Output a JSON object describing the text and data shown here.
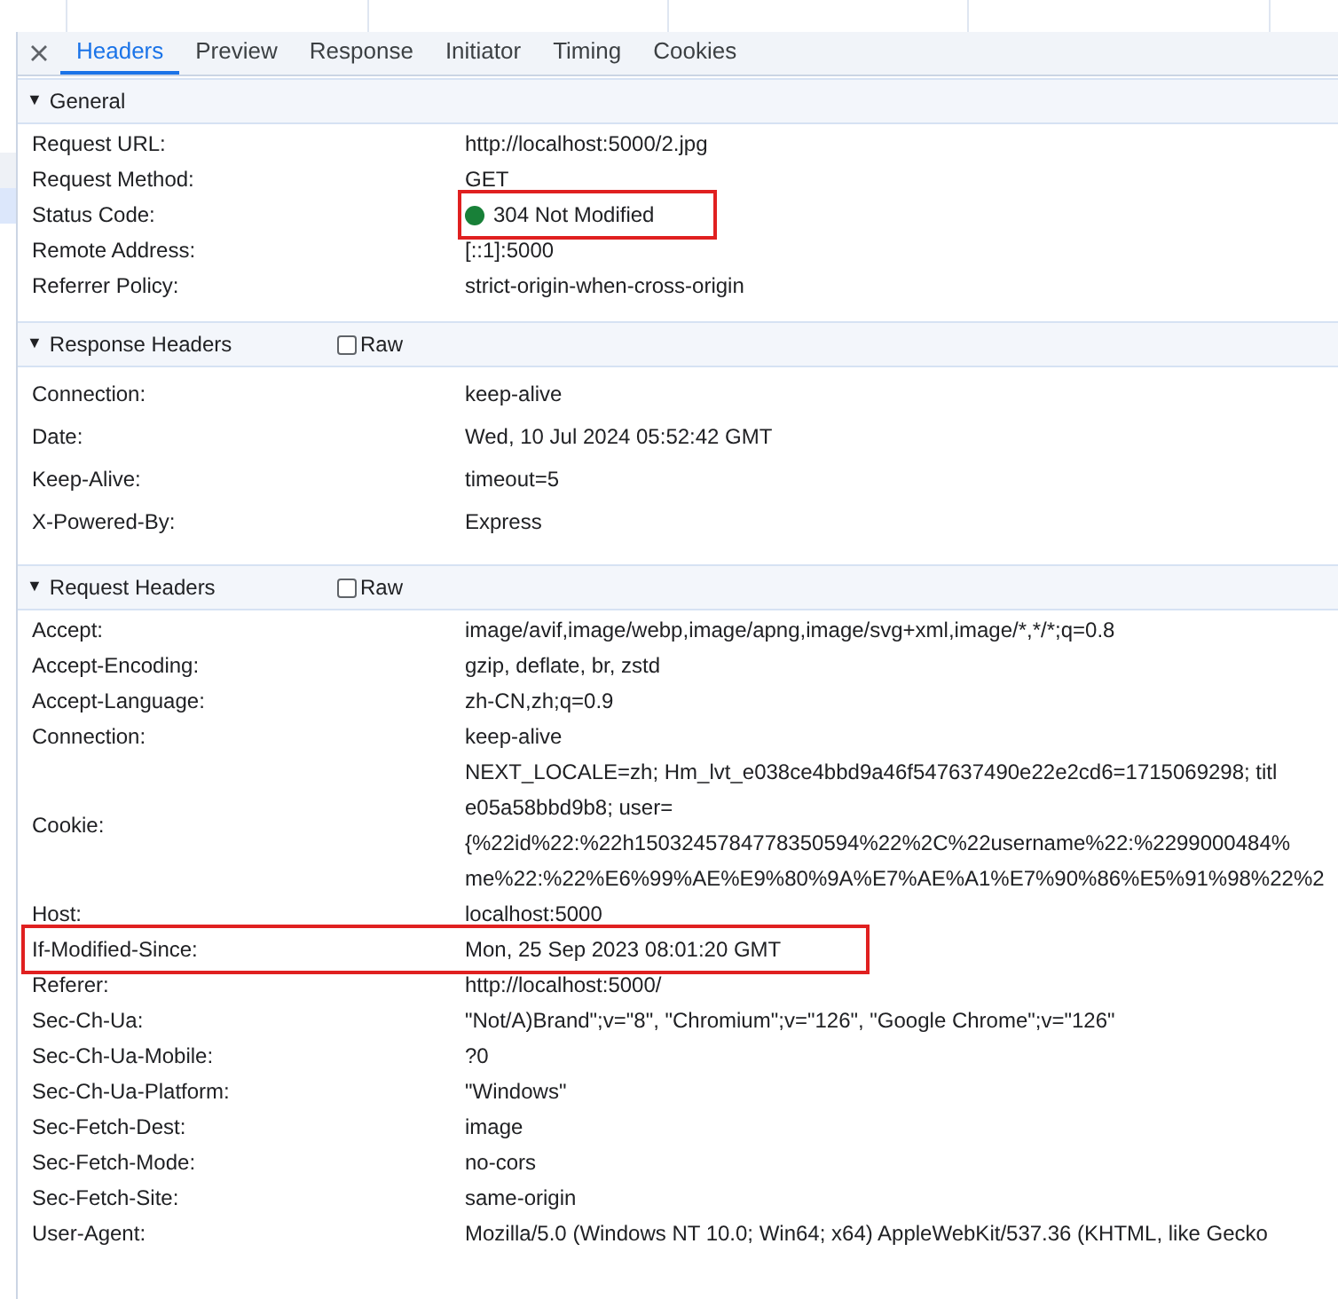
{
  "tabs": [
    {
      "label": "Headers",
      "selected": true
    },
    {
      "label": "Preview",
      "selected": false
    },
    {
      "label": "Response",
      "selected": false
    },
    {
      "label": "Initiator",
      "selected": false
    },
    {
      "label": "Timing",
      "selected": false
    },
    {
      "label": "Cookies",
      "selected": false
    }
  ],
  "sections": [
    {
      "title": "General",
      "marker": "▼",
      "rows": [
        {
          "name": "Request URL:",
          "value": [
            "http://localhost:5000/2.jpg"
          ],
          "kind": "plain",
          "highlighted": false
        },
        {
          "name": "Request Method:",
          "value": [
            "GET"
          ],
          "kind": "plain",
          "highlighted": false
        },
        {
          "name": "Status Code:",
          "value": [
            "304 Not Modified"
          ],
          "kind": "status",
          "highlighted": true
        },
        {
          "name": "Remote Address:",
          "value": [
            "[::1]:5000"
          ],
          "kind": "plain",
          "highlighted": false
        },
        {
          "name": "Referrer Policy:",
          "value": [
            "strict-origin-when-cross-origin"
          ],
          "kind": "plain",
          "highlighted": false
        }
      ]
    },
    {
      "title": "Response Headers",
      "marker": "▼",
      "raw": {
        "label": "Raw",
        "checked": false
      },
      "rows": [
        {
          "name": "Connection:",
          "value": [
            "keep-alive"
          ],
          "kind": "plain",
          "highlighted": false
        },
        {
          "name": "Date:",
          "value": [
            "Wed, 10 Jul 2024 05:52:42 GMT"
          ],
          "kind": "plain",
          "highlighted": false
        },
        {
          "name": "Keep-Alive:",
          "value": [
            "timeout=5"
          ],
          "kind": "plain",
          "highlighted": false
        },
        {
          "name": "X-Powered-By:",
          "value": [
            "Express"
          ],
          "kind": "plain",
          "highlighted": false
        }
      ]
    },
    {
      "title": "Request Headers",
      "marker": "▼",
      "raw": {
        "label": "Raw",
        "checked": false
      },
      "rows": [
        {
          "name": "Accept:",
          "value": [
            "image/avif,image/webp,image/apng,image/svg+xml,image/*,*/*;q=0.8"
          ],
          "kind": "plain",
          "highlighted": false
        },
        {
          "name": "Accept-Encoding:",
          "value": [
            "gzip, deflate, br, zstd"
          ],
          "kind": "plain",
          "highlighted": false
        },
        {
          "name": "Accept-Language:",
          "value": [
            "zh-CN,zh;q=0.9"
          ],
          "kind": "plain",
          "highlighted": false
        },
        {
          "name": "Connection:",
          "value": [
            "keep-alive"
          ],
          "kind": "plain",
          "highlighted": false
        },
        {
          "name": "Cookie:",
          "value": [
            "NEXT_LOCALE=zh; Hm_lvt_e038ce4bbd9a46f547637490e22e2cd6=1715069298; titl",
            "e05a58bbd9b8; user=",
            "{%22id%22:%22h1503245784778350594%22%2C%22username%22:%2299000484%",
            "me%22:%22%E6%99%AE%E9%80%9A%E7%AE%A1%E7%90%86%E5%91%98%22%2"
          ],
          "kind": "plain",
          "highlighted": false
        },
        {
          "name": "Host:",
          "value": [
            "localhost:5000"
          ],
          "kind": "plain",
          "highlighted": false
        },
        {
          "name": "If-Modified-Since:",
          "value": [
            "Mon, 25 Sep 2023 08:01:20 GMT"
          ],
          "kind": "plain",
          "highlighted": true
        },
        {
          "name": "Referer:",
          "value": [
            "http://localhost:5000/"
          ],
          "kind": "plain",
          "highlighted": false
        },
        {
          "name": "Sec-Ch-Ua:",
          "value": [
            "\"Not/A)Brand\";v=\"8\", \"Chromium\";v=\"126\", \"Google Chrome\";v=\"126\""
          ],
          "kind": "plain",
          "highlighted": false
        },
        {
          "name": "Sec-Ch-Ua-Mobile:",
          "value": [
            "?0"
          ],
          "kind": "plain",
          "highlighted": false
        },
        {
          "name": "Sec-Ch-Ua-Platform:",
          "value": [
            "\"Windows\""
          ],
          "kind": "plain",
          "highlighted": false
        },
        {
          "name": "Sec-Fetch-Dest:",
          "value": [
            "image"
          ],
          "kind": "plain",
          "highlighted": false
        },
        {
          "name": "Sec-Fetch-Mode:",
          "value": [
            "no-cors"
          ],
          "kind": "plain",
          "highlighted": false
        },
        {
          "name": "Sec-Fetch-Site:",
          "value": [
            "same-origin"
          ],
          "kind": "plain",
          "highlighted": false
        },
        {
          "name": "User-Agent:",
          "value": [
            "Mozilla/5.0 (Windows NT 10.0; Win64; x64) AppleWebKit/537.36 (KHTML, like Gecko"
          ],
          "kind": "plain",
          "highlighted": false
        }
      ]
    }
  ]
}
